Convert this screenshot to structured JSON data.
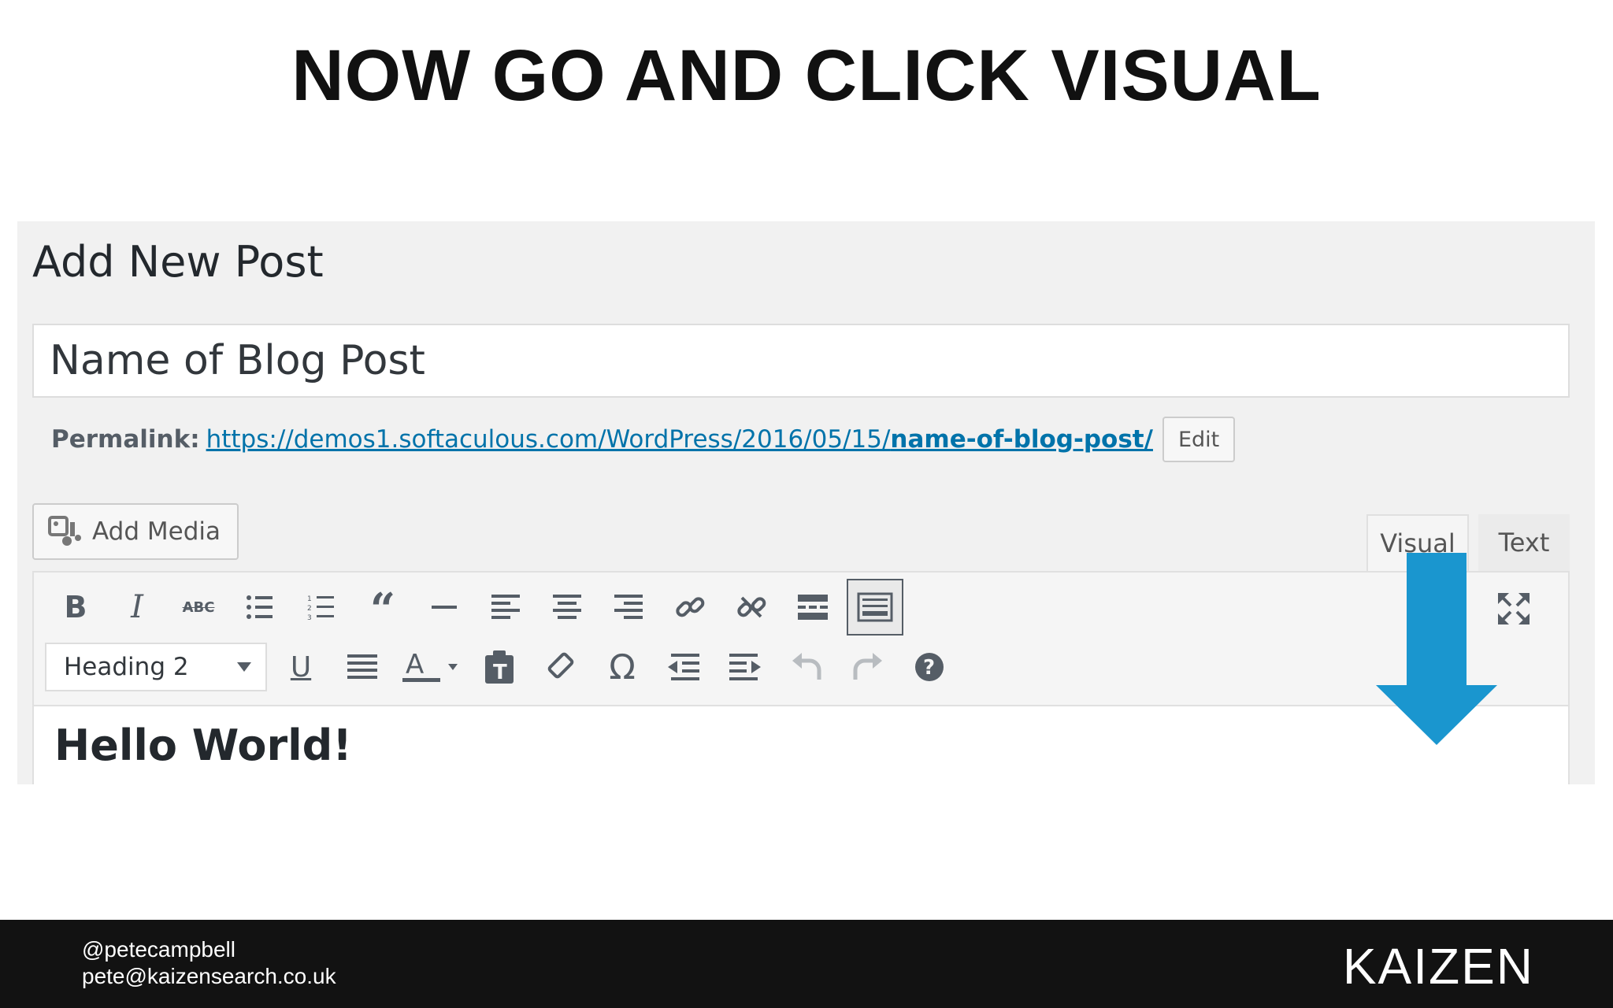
{
  "slide": {
    "title": "NOW GO AND CLICK VISUAL"
  },
  "editor": {
    "page_heading": "Add New Post",
    "post_title": "Name of Blog Post",
    "permalink_label": "Permalink:",
    "permalink_base": "https://demos1.softaculous.com/WordPress/2016/05/15/",
    "permalink_slug": "name-of-blog-post/",
    "edit_label": "Edit",
    "add_media_label": "Add Media",
    "tabs": [
      {
        "label": "Visual",
        "active": true
      },
      {
        "label": "Text",
        "active": false
      }
    ],
    "toolbar_row1_icons": [
      "bold-icon",
      "italic-icon",
      "strikethrough-icon",
      "bulleted-list-icon",
      "numbered-list-icon",
      "blockquote-icon",
      "horizontal-line-icon",
      "align-left-icon",
      "align-center-icon",
      "align-right-icon",
      "insert-link-icon",
      "remove-link-icon",
      "read-more-icon",
      "toolbar-toggle-icon",
      "fullscreen-icon"
    ],
    "format_select_value": "Heading 2",
    "toolbar_row2_icons": [
      "underline-icon",
      "justify-icon",
      "text-color-icon",
      "paste-as-text-icon",
      "clear-formatting-icon",
      "special-character-icon",
      "decrease-indent-icon",
      "increase-indent-icon",
      "undo-icon",
      "redo-icon",
      "help-icon"
    ],
    "content_heading": "Hello World!"
  },
  "arrow_color": "#1a96cf",
  "footer": {
    "handle": "@petecampbell",
    "email": "pete@kaizensearch.co.uk",
    "logo": "KAIZEN"
  }
}
